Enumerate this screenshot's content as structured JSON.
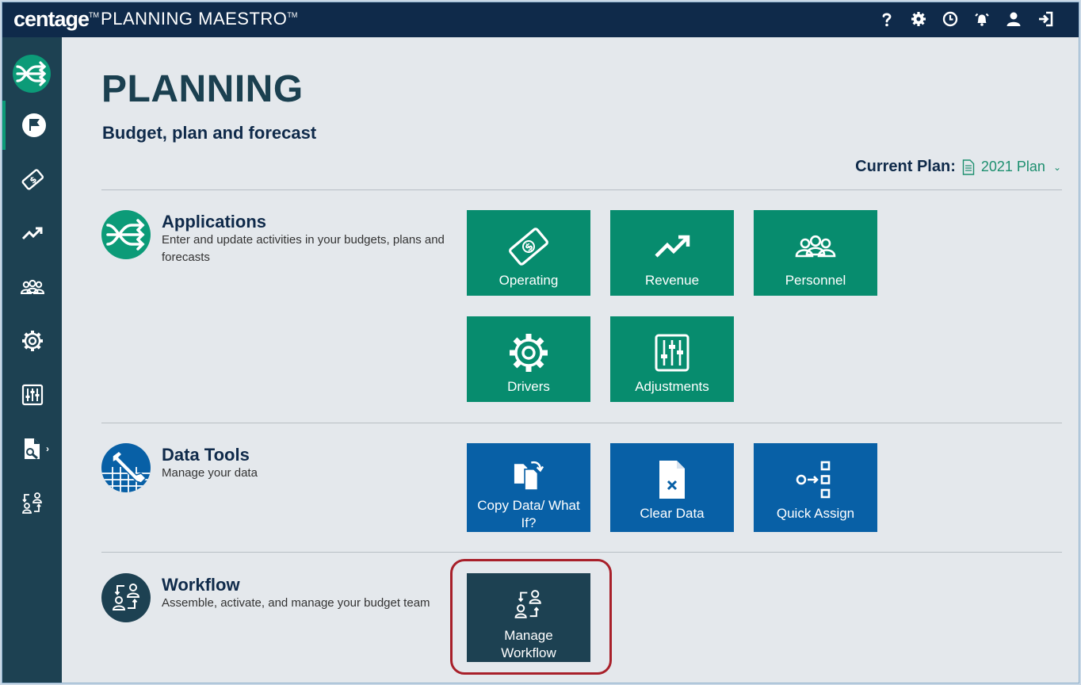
{
  "header": {
    "brand_name": "centage",
    "brand_tm": "TM",
    "product_name": "PLANNING MAESTRO",
    "product_tm": "TM",
    "icons": [
      "help-icon",
      "settings-icon",
      "clock-icon",
      "alarm-icon",
      "user-icon",
      "logout-icon"
    ]
  },
  "sidebar": {
    "items": [
      {
        "name": "planning",
        "icon": "flag-icon",
        "active": true
      },
      {
        "name": "operating",
        "icon": "money-icon"
      },
      {
        "name": "revenue",
        "icon": "trend-icon"
      },
      {
        "name": "personnel",
        "icon": "people-icon"
      },
      {
        "name": "drivers",
        "icon": "gear-icon"
      },
      {
        "name": "adjustments",
        "icon": "sliders-icon"
      },
      {
        "name": "reports",
        "icon": "report-icon"
      },
      {
        "name": "workflow",
        "icon": "workflow-icon"
      }
    ],
    "expand_arrow": "›"
  },
  "page": {
    "title": "PLANNING",
    "subtitle": "Budget, plan and forecast",
    "current_plan_label": "Current Plan:",
    "current_plan_value": "2021 Plan",
    "current_plan_chevron": "⌄"
  },
  "sections": {
    "applications": {
      "title": "Applications",
      "description": "Enter and update activities in your budgets, plans and forecasts",
      "tiles": [
        {
          "label": "Operating",
          "icon": "money-icon"
        },
        {
          "label": "Revenue",
          "icon": "trend-icon"
        },
        {
          "label": "Personnel",
          "icon": "people-icon"
        },
        {
          "label": "Drivers",
          "icon": "gear-icon"
        },
        {
          "label": "Adjustments",
          "icon": "sliders-icon"
        }
      ]
    },
    "data_tools": {
      "title": "Data Tools",
      "description": "Manage your data",
      "tiles": [
        {
          "label": "Copy Data/ What If?",
          "icon": "copy-icon"
        },
        {
          "label": "Clear Data",
          "icon": "clear-data-icon"
        },
        {
          "label": "Quick Assign",
          "icon": "quick-assign-icon"
        }
      ]
    },
    "workflow": {
      "title": "Workflow",
      "description": "Assemble, activate, and manage your budget team",
      "tiles": [
        {
          "label": "Manage Workflow",
          "icon": "workflow-icon"
        }
      ]
    }
  },
  "colors": {
    "topbar": "#0f2a4a",
    "sidebar": "#1d4152",
    "green_tile": "#078c6e",
    "blue_tile": "#0860a6",
    "dark_tile": "#1d4152",
    "highlight": "#a8202a"
  }
}
